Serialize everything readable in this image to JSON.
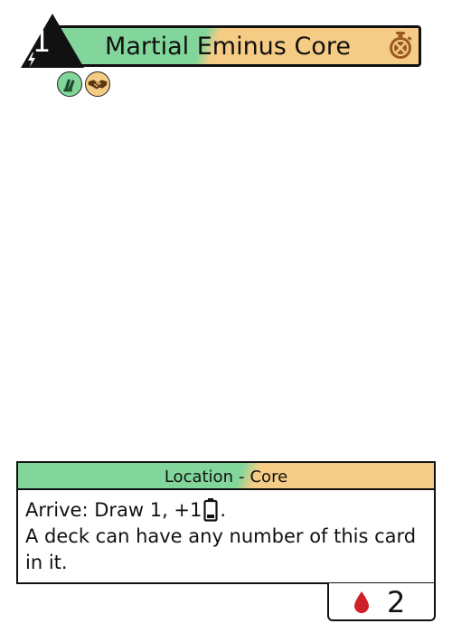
{
  "card": {
    "title": "Martial Eminus Core",
    "cost": "1",
    "type": "Location",
    "separator": "-",
    "subtype": "Core",
    "rules_line1_prefix": "Arrive: Draw 1, +1",
    "rules_line1_suffix": ".",
    "rules_line2": "A deck can have any number of this card in it.",
    "blood_cost": "2"
  },
  "icons": {
    "faction": "stopwatch-icon",
    "cost_subicon": "lightning-icon",
    "trait_1": "gloves-icon",
    "trait_2": "handshake-icon",
    "rules_inline": "battery-icon",
    "blood": "blood-drop-icon"
  },
  "colors": {
    "green": "#82d69b",
    "gold": "#f5cc86",
    "brown": "#9a5a22",
    "blood": "#d0202a",
    "ink": "#111111"
  }
}
